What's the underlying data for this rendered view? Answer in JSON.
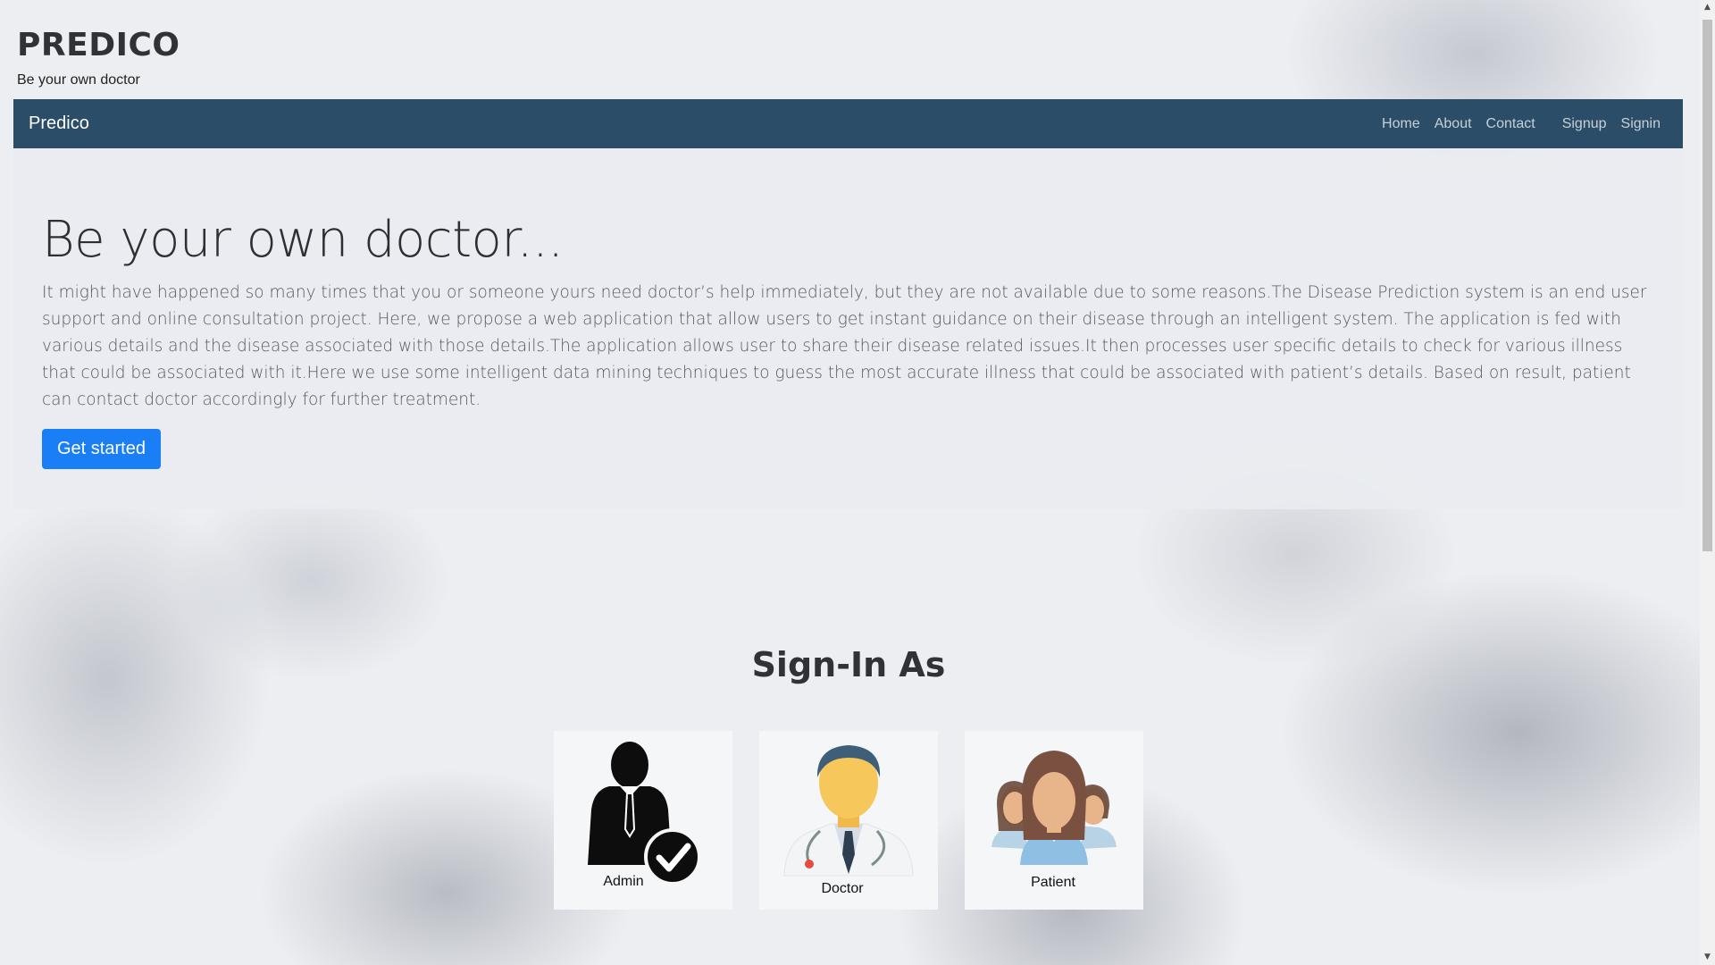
{
  "brand": {
    "title": "PREDICO",
    "tagline": "Be your own doctor"
  },
  "navbar": {
    "brand": "Predico",
    "links": [
      "Home",
      "About",
      "Contact",
      "Signup",
      "Signin"
    ]
  },
  "hero": {
    "title": "Be your own doctor...",
    "text": "It might have happened so many times that you or someone yours need doctor’s help immediately, but they are not available due to some reasons.The Disease Prediction system is an end user support and online consultation project. Here, we propose a web application that allow users to get instant guidance on their disease through an intelligent system. The application is fed with various details and the disease associated with those details.The application allows user to share their disease related issues.It then processes user specific details to check for various illness that could be associated with it.Here we use some intelligent data mining techniques to guess the most accurate illness that could be associated with patient’s details. Based on result, patient can contact doctor accordingly for further treatment.",
    "button": "Get started"
  },
  "signin": {
    "title": "Sign-In As",
    "roles": [
      {
        "label": "Admin",
        "icon": "admin-icon"
      },
      {
        "label": "Doctor",
        "icon": "doctor-icon"
      },
      {
        "label": "Patient",
        "icon": "patient-icon"
      }
    ]
  },
  "colors": {
    "navbar": "#2b4d67",
    "button": "#1a7ef7"
  }
}
